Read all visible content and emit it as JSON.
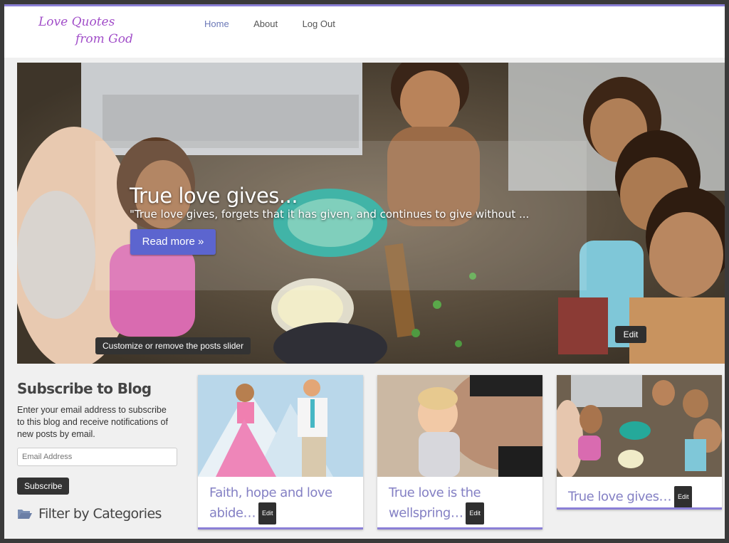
{
  "site": {
    "logo_line1": "Love Quotes",
    "logo_line2": "from God"
  },
  "nav": {
    "items": [
      {
        "label": "Home",
        "active": true
      },
      {
        "label": "About",
        "active": false
      },
      {
        "label": "Log Out",
        "active": false
      }
    ]
  },
  "slider": {
    "title": "True love gives...",
    "excerpt": "\"True love gives, forgets that it has given, and continues to give without ...",
    "read_more_label": "Read more »",
    "customize_label": "Customize or remove the posts slider",
    "edit_label": "Edit"
  },
  "sidebar": {
    "subscribe_title": "Subscribe to Blog",
    "subscribe_text": "Enter your email address to subscribe to this blog and receive notifications of new posts by email.",
    "email_placeholder": "Email Address",
    "subscribe_button": "Subscribe",
    "filter_title": "Filter by Categories"
  },
  "posts": [
    {
      "title": "Faith, hope and love abide…",
      "edit_label": "Edit"
    },
    {
      "title": "True love is the wellspring…",
      "edit_label": "Edit"
    },
    {
      "title": "True love gives…",
      "edit_label": "Edit"
    }
  ],
  "colors": {
    "accent": "#8a7fd6",
    "button_blue": "#5c65cf",
    "title_purple": "#8480c4",
    "logo_purple": "#a24fc9"
  }
}
